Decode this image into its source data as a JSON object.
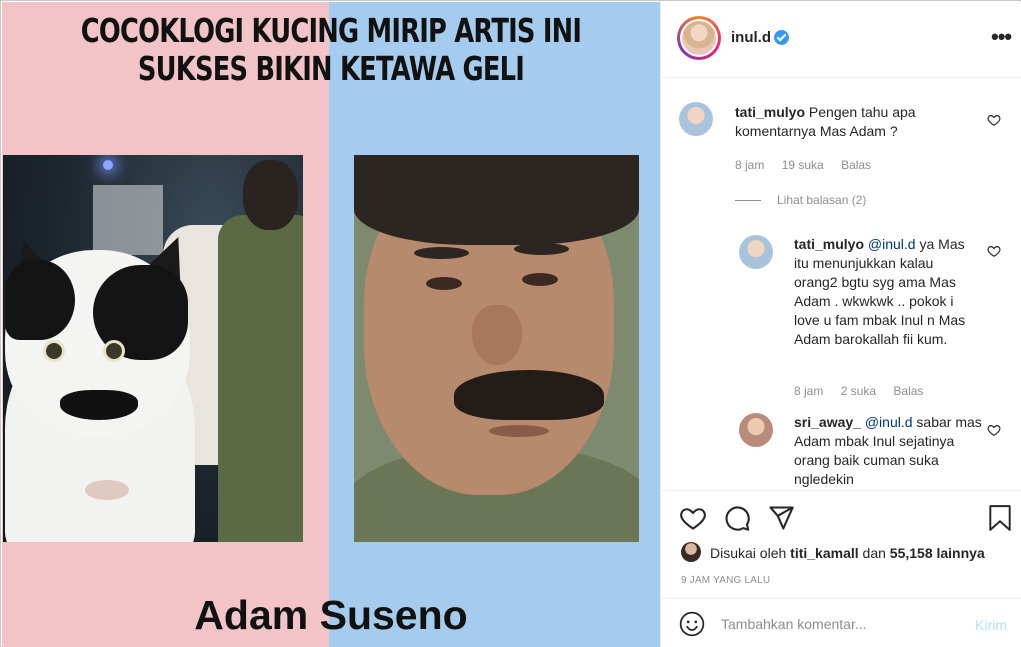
{
  "media": {
    "headline_line1": "COCOKLOGI KUCING MIRIP ARTIS INI",
    "headline_line2": "SUKSES BIKIN KETAWA GELI",
    "caption_name": "Adam Suseno"
  },
  "post": {
    "owner": "inul.d",
    "verified": true,
    "more_icon": "more-dots-icon"
  },
  "comments": [
    {
      "username": "tati_mulyo",
      "text": "Pengen tahu apa komentarnya Mas Adam ?",
      "time": "8 jam",
      "likes": "19 suka",
      "reply": "Balas",
      "view_replies": "Lihat balasan (2)"
    },
    {
      "username": "tati_mulyo",
      "mention": "@inul.d",
      "text": "ya Mas itu menunjukkan kalau orang2 bgtu syg ama Mas Adam . wkwkwk .. pokok i love u fam mbak Inul n Mas Adam barokallah fii kum.",
      "time": "8 jam",
      "likes": "2 suka",
      "reply": "Balas"
    },
    {
      "username": "sri_away_",
      "mention": "@inul.d",
      "text": "sabar mas Adam mbak Inul sejatinya orang baik cuman suka ngledekin"
    }
  ],
  "likes": {
    "prefix": "Disukai oleh",
    "user": "titi_kamall",
    "connector": "dan",
    "count": "55,158 lainnya"
  },
  "timestamp": "9 JAM YANG LALU",
  "add_comment": {
    "placeholder": "Tambahkan komentar...",
    "post_label": "Kirim"
  },
  "colors": {
    "accent": "#3897f0",
    "post_disabled": "#b2dffc",
    "muted": "#8e8e8e",
    "bg_left": "#f2c3c7",
    "bg_right": "#a5cbee"
  }
}
